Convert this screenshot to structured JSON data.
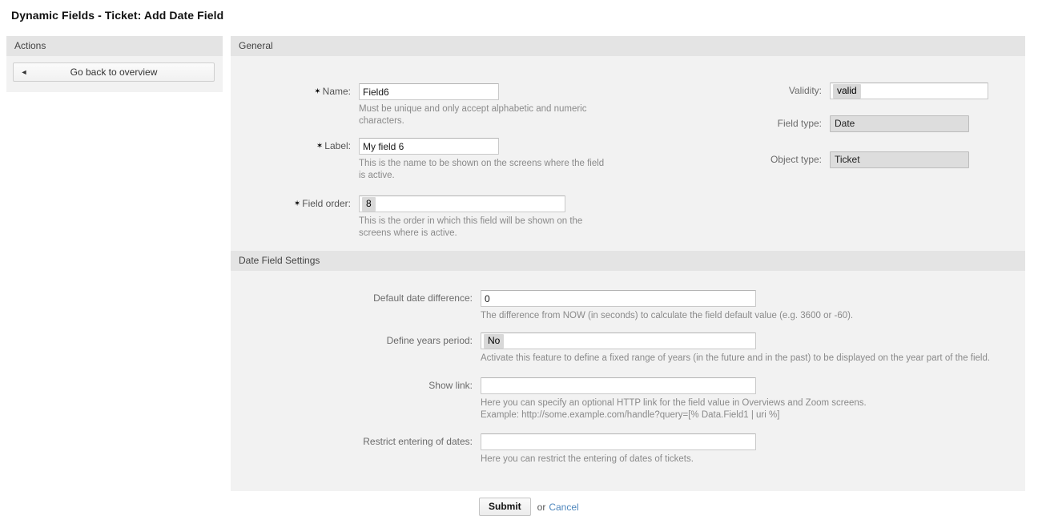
{
  "page": {
    "title": "Dynamic Fields - Ticket: Add Date Field"
  },
  "actions": {
    "header": "Actions",
    "back_button": {
      "label": "Go back to overview",
      "arrow_glyph": "◄"
    }
  },
  "general": {
    "header": "General",
    "fields": {
      "name": {
        "label": "Name:",
        "required_marker": "✶",
        "value": "Field6",
        "help": "Must be unique and only accept alphabetic and numeric\ncharacters."
      },
      "label": {
        "label": "Label:",
        "required_marker": "✶",
        "value": "My field 6",
        "help": "This is the name to be shown on the screens where the field\nis active."
      },
      "field_order": {
        "label": "Field order:",
        "required_marker": "✶",
        "value": "8",
        "help": "This is the order in which this field will be shown on the\nscreens where is active."
      },
      "validity": {
        "label": "Validity:",
        "value": "valid"
      },
      "field_type": {
        "label": "Field type:",
        "value": "Date"
      },
      "object_type": {
        "label": "Object type:",
        "value": "Ticket"
      }
    }
  },
  "date_settings": {
    "header": "Date Field Settings",
    "fields": {
      "default_date_difference": {
        "label": "Default date difference:",
        "value": "0",
        "help": "The difference from NOW (in seconds) to calculate the field default value (e.g. 3600 or -60)."
      },
      "define_years_period": {
        "label": "Define years period:",
        "value": "No",
        "help": "Activate this feature to define a fixed range of years (in the future and in the past) to be displayed on the year part of the field."
      },
      "show_link": {
        "label": "Show link:",
        "value": "",
        "placeholder": "",
        "help": "Here you can specify an optional HTTP link for the field value in Overviews and Zoom screens.\nExample: http://some.example.com/handle?query=[% Data.Field1 | uri %]"
      },
      "restrict_entering_of_dates": {
        "label": "Restrict entering of dates:",
        "value": "",
        "placeholder": "",
        "help": "Here you can restrict the entering of dates of tickets."
      }
    }
  },
  "footer": {
    "submit_label": "Submit",
    "or_text": "or",
    "cancel_label": "Cancel"
  },
  "colors": {
    "panel_header": "#e4e4e4",
    "panel_body": "#f2f2f2",
    "link": "#4f87bd",
    "help_text": "#8a8a8a"
  }
}
